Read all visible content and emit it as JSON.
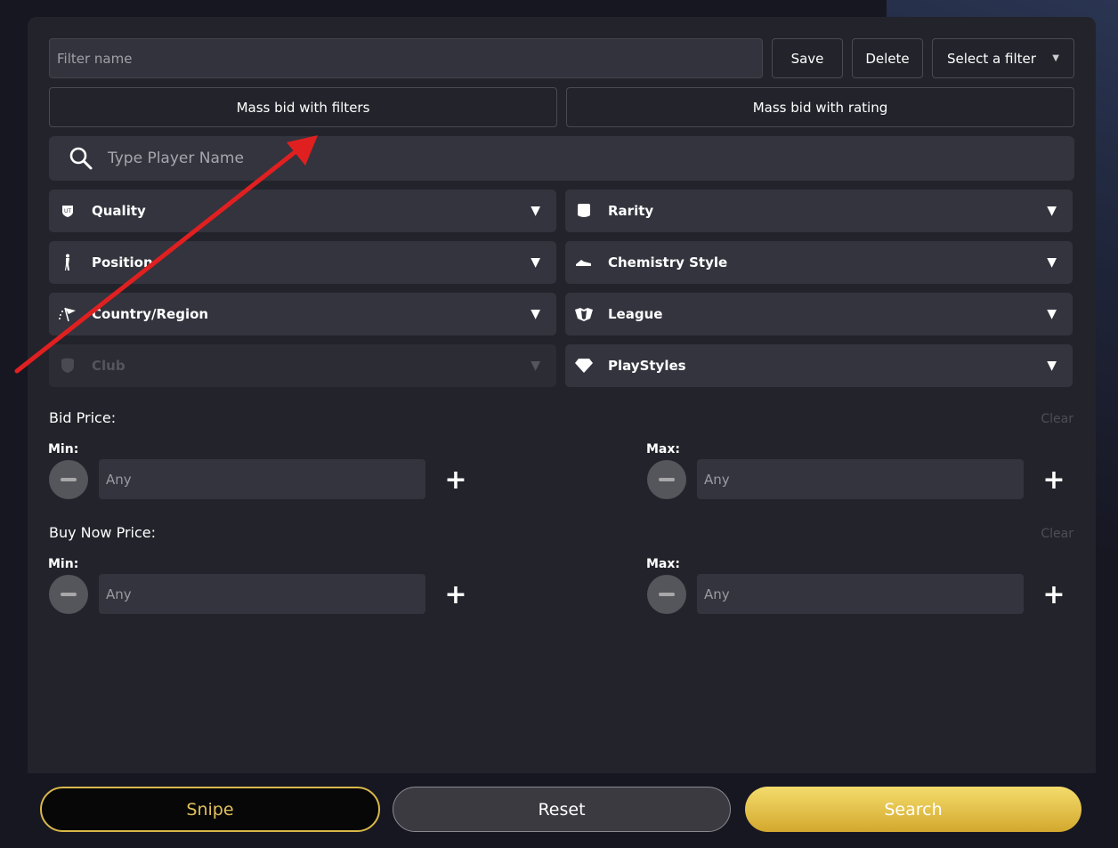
{
  "filter": {
    "name_placeholder": "Filter name",
    "save_label": "Save",
    "delete_label": "Delete",
    "select_label": "Select a filter",
    "select_caret": "▼"
  },
  "mass_bid": {
    "filters_label": "Mass bid with filters",
    "rating_label": "Mass bid with rating"
  },
  "search": {
    "placeholder": "Type Player Name",
    "icon": "search-icon"
  },
  "dropdowns": [
    {
      "label": "Quality",
      "icon": "quality-icon",
      "arrow": "▼"
    },
    {
      "label": "Rarity",
      "icon": "rarity-icon",
      "arrow": "▼"
    },
    {
      "label": "Position",
      "icon": "position-icon",
      "arrow": "▼"
    },
    {
      "label": "Chemistry Style",
      "icon": "chemistry-style-icon",
      "arrow": "▼"
    },
    {
      "label": "Country/Region",
      "icon": "country-region-icon",
      "arrow": "▼"
    },
    {
      "label": "League",
      "icon": "league-icon",
      "arrow": "▼"
    },
    {
      "label": "Club",
      "icon": "club-icon",
      "arrow": "▼",
      "disabled": true
    },
    {
      "label": "PlayStyles",
      "icon": "playstyles-icon",
      "arrow": "▼"
    }
  ],
  "bid_price": {
    "title": "Bid Price:",
    "clear": "Clear",
    "min_label": "Min:",
    "max_label": "Max:",
    "min_placeholder": "Any",
    "max_placeholder": "Any",
    "plus": "+"
  },
  "buy_now_price": {
    "title": "Buy Now Price:",
    "clear": "Clear",
    "min_label": "Min:",
    "max_label": "Max:",
    "min_placeholder": "Any",
    "max_placeholder": "Any",
    "plus": "+"
  },
  "actions": {
    "snipe": "Snipe",
    "reset": "Reset",
    "search": "Search"
  },
  "colors": {
    "accent_gold": "#d9b84a",
    "annotation_arrow": "#e02020",
    "panel": "#23232b"
  }
}
